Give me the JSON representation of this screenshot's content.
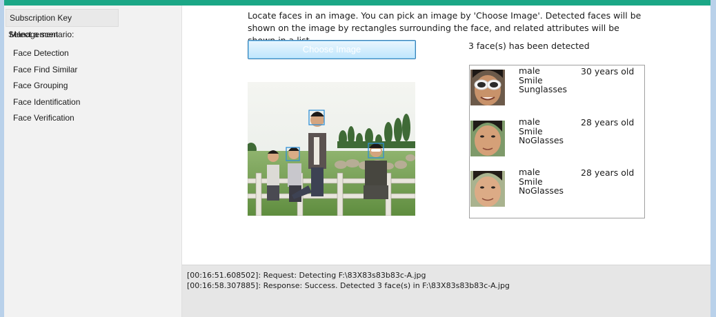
{
  "sidebar": {
    "key_management": "Subscription Key Management",
    "scenario_label": "Select a scenario:",
    "scenarios": [
      "Face Detection",
      "Face Find Similar",
      "Face Grouping",
      "Face Identification",
      "Face Verification"
    ]
  },
  "main": {
    "description": "Locate faces in an image. You can pick an image by 'Choose Image'. Detected faces will be shown on the image by rectangles surrounding the face, and related attributes will be shown in a list.",
    "choose_button": "Choose Image",
    "detect_status": "3 face(s) has been detected"
  },
  "faces": [
    {
      "gender": "male",
      "expression": "Smile",
      "glasses": "Sunglasses",
      "age": "30 years old"
    },
    {
      "gender": "male",
      "expression": "Smile",
      "glasses": "NoGlasses",
      "age": "28 years old"
    },
    {
      "gender": "male",
      "expression": "Smile",
      "glasses": "NoGlasses",
      "age": "28 years old"
    }
  ],
  "log": [
    "[00:16:51.608502]: Request: Detecting F:\\83X83s83b83c-A.jpg",
    "[00:16:58.307885]: Response: Success. Detected 3 face(s) in F:\\83X83s83b83c-A.jpg"
  ],
  "colors": {
    "title_accent": "#1ba786",
    "window_frame": "#b9d1ea",
    "face_box": "#2f8fd6",
    "button_border": "#3c7fb1"
  }
}
